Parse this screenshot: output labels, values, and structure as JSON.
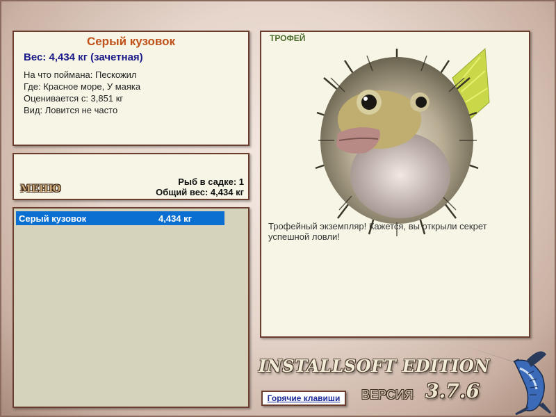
{
  "fish_info": {
    "title": "Серый кузовок",
    "weight_line": "Вес: 4,434 кг (зачетная)",
    "bait_line": "На что поймана: Пескожил",
    "location_line": "Где: Красное море, У маяка",
    "rating_line": "Оценивается с: 3,851 кг",
    "kind_line": "Вид: Ловится не часто"
  },
  "summary": {
    "menu_label": "МЕНЮ",
    "fish_in_cage": "Рыб в садке: 1",
    "total_weight": "Общий вес: 4,434 кг"
  },
  "catch_list": [
    {
      "name": "Серый кузовок",
      "weight": "4,434 кг"
    }
  ],
  "trophy": {
    "label": "ТРОФЕЙ",
    "description": "Трофейный экземпляр! Кажется, вы открыли секрет успешной ловли!"
  },
  "branding": {
    "edition": "INSTALLSOFT EDITION",
    "version_label": "ВЕРСИЯ",
    "version_number": "3.7.6"
  },
  "hotkeys_link": "Горячие клавиши",
  "colors": {
    "panel_bg": "#f7f5e6",
    "panel_border": "#6b3d2e",
    "title_orange": "#c0501a",
    "weight_blue": "#1a1a88",
    "selection_blue": "#0a6fd0"
  }
}
